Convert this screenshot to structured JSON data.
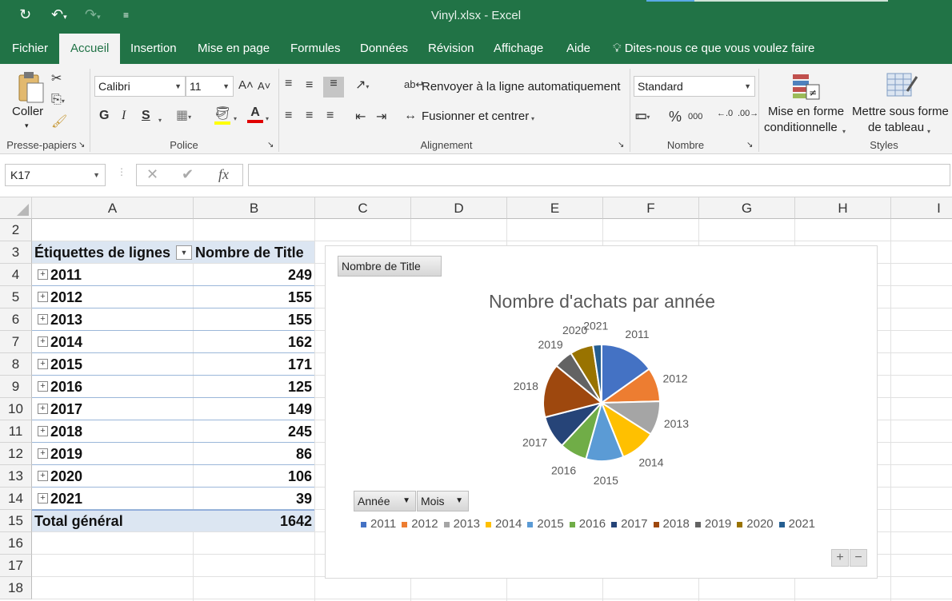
{
  "titlebar": {
    "title": "Vinyl.xlsx  -  Excel"
  },
  "tabs": [
    "Fichier",
    "Accueil",
    "Insertion",
    "Mise en page",
    "Formules",
    "Données",
    "Révision",
    "Affichage",
    "Aide"
  ],
  "tell_me": "Dites-nous ce que vous voulez faire",
  "ribbon": {
    "paste_label": "Coller",
    "clipboard_label": "Presse-papiers",
    "font_name": "Calibri",
    "font_size": "11",
    "font_label": "Police",
    "bold": "G",
    "italic": "I",
    "underline": "S",
    "wrap_text": "Renvoyer à la ligne automatiquement",
    "merge_center": "Fusionner et centrer",
    "alignment_label": "Alignement",
    "number_format": "Standard",
    "number_label": "Nombre",
    "percent": "%",
    "thousands": "000",
    "cond_format_line1": "Mise en forme",
    "cond_format_line2": "conditionnelle",
    "table_format_line1": "Mettre sous forme",
    "table_format_line2": "de tableau",
    "styles_label": "Styles"
  },
  "formula_bar": {
    "name_box": "K17",
    "fx": "fx",
    "formula": ""
  },
  "columns": [
    "A",
    "B",
    "C",
    "D",
    "E",
    "F",
    "G",
    "H",
    "I"
  ],
  "rows": [
    "2",
    "3",
    "4",
    "5",
    "6",
    "7",
    "8",
    "9",
    "10",
    "11",
    "12",
    "13",
    "14",
    "15",
    "16",
    "17",
    "18"
  ],
  "pivot": {
    "header_label": "Étiquettes de lignes",
    "header_value": "Nombre de Title",
    "items": [
      {
        "label": "2011",
        "value": "249"
      },
      {
        "label": "2012",
        "value": "155"
      },
      {
        "label": "2013",
        "value": "155"
      },
      {
        "label": "2014",
        "value": "162"
      },
      {
        "label": "2015",
        "value": "171"
      },
      {
        "label": "2016",
        "value": "125"
      },
      {
        "label": "2017",
        "value": "149"
      },
      {
        "label": "2018",
        "value": "245"
      },
      {
        "label": "2019",
        "value": "86"
      },
      {
        "label": "2020",
        "value": "106"
      },
      {
        "label": "2021",
        "value": "39"
      }
    ],
    "total_label": "Total général",
    "total_value": "1642"
  },
  "chart": {
    "value_field_button": "Nombre de Title",
    "axis_field_buttons": [
      "Année",
      "Mois"
    ],
    "zoom_in": "+",
    "zoom_out": "−",
    "colors": [
      "#4472c4",
      "#ed7d31",
      "#a5a5a5",
      "#ffc000",
      "#5b9bd5",
      "#70ad47",
      "#264478",
      "#9e480e",
      "#636363",
      "#997300",
      "#255e91"
    ]
  },
  "chart_data": {
    "type": "pie",
    "title": "Nombre d'achats par année",
    "categories": [
      "2011",
      "2012",
      "2013",
      "2014",
      "2015",
      "2016",
      "2017",
      "2018",
      "2019",
      "2020",
      "2021"
    ],
    "values": [
      249,
      155,
      155,
      162,
      171,
      125,
      149,
      245,
      86,
      106,
      39
    ],
    "legend": "bottom"
  }
}
